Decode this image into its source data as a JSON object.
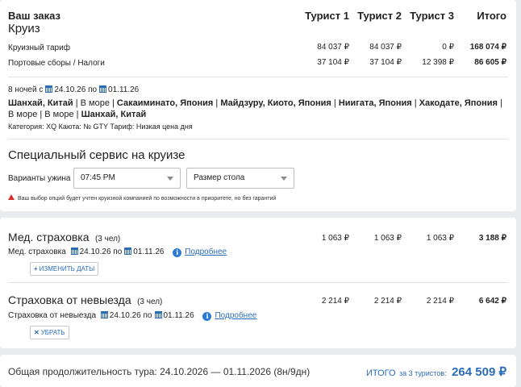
{
  "order": {
    "title": "Ваш заказ",
    "subtitle": "Круиз",
    "columns": [
      "Турист 1",
      "Турист 2",
      "Турист 3",
      "Итого"
    ],
    "rows": [
      {
        "label": "Круизный тариф",
        "values": [
          "84 037 ₽",
          "84 037 ₽",
          "0 ₽",
          "168 074 ₽"
        ]
      },
      {
        "label": "Портовые сборы / Налоги",
        "values": [
          "37 104 ₽",
          "37 104 ₽",
          "12 398 ₽",
          "86 605 ₽"
        ]
      }
    ],
    "duration": "8 ночей с",
    "date_from": "24.10.26",
    "date_to_sep": "по",
    "date_to": "01.11.26",
    "route": [
      {
        "text": "Шанхай, Китай",
        "bold": true
      },
      {
        "text": " | В море | ",
        "bold": false
      },
      {
        "text": "Сакаиминато, Япония",
        "bold": true
      },
      {
        "text": " | ",
        "bold": false
      },
      {
        "text": "Майдзуру, Киото, Япония",
        "bold": true
      },
      {
        "text": " | ",
        "bold": false
      },
      {
        "text": "Ниигата, Япония",
        "bold": true
      },
      {
        "text": " | ",
        "bold": false
      },
      {
        "text": "Хакодате, Япония",
        "bold": true
      },
      {
        "text": " | В море | В море | ",
        "bold": false
      },
      {
        "text": "Шанхай, Китай",
        "bold": true
      }
    ],
    "details": "Категория: XQ   Каюта: № GTY   Тариф: Низкая цена дня"
  },
  "special": {
    "title": "Специальный сервис на круизе",
    "dinner_label": "Варианты ужина",
    "dinner_value": "07:45 PM",
    "table_value": "Размер стола",
    "warning": "Ваш выбор опций будет учтен круизной компанией по возможности в приоритете, но без гарантий"
  },
  "insurance": [
    {
      "title": "Мед. страховка",
      "people": "(3 чел)",
      "values": [
        "1 063 ₽",
        "1 063 ₽",
        "1 063 ₽",
        "3 188 ₽"
      ],
      "sub_label": "Мед. страховка",
      "date_from": "24.10.26",
      "date_sep": "по",
      "date_to": "01.11.26",
      "more_link": "Подробнее",
      "action": "ИЗМЕНИТЬ ДАТЫ",
      "action_glyph": "+"
    },
    {
      "title": "Страховка от невыезда",
      "people": "(3 чел)",
      "values": [
        "2 214 ₽",
        "2 214 ₽",
        "2 214 ₽",
        "6 642 ₽"
      ],
      "sub_label": "Страховка от невыезда",
      "date_from": "24.10.26",
      "date_sep": "по",
      "date_to": "01.11.26",
      "more_link": "Подробнее",
      "action": "УБРАТЬ",
      "action_glyph": "✕"
    }
  ],
  "footer": {
    "duration_text": "Общая продолжительность тура: 24.10.2026 — 01.11.2026 (8н/9дн)",
    "total_label": "ИТОГО",
    "total_for": "за 3 туристов:",
    "total_value": "264 509 ₽"
  },
  "colors": {
    "accent": "#2b6cb8",
    "warning": "#d9302c",
    "background": "#e9ebee"
  }
}
